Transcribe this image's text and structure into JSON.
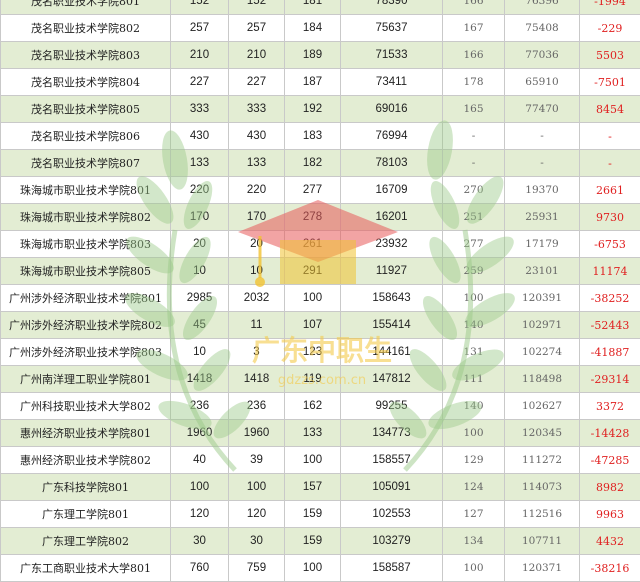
{
  "watermark": {
    "text": "广东中职生",
    "subtext": "gdzzs.com.cn"
  },
  "rows": [
    [
      "茂名职业技术学院801",
      "152",
      "152",
      "181",
      "78390",
      "166",
      "76396",
      "-1994"
    ],
    [
      "茂名职业技术学院802",
      "257",
      "257",
      "184",
      "75637",
      "167",
      "75408",
      "-229"
    ],
    [
      "茂名职业技术学院803",
      "210",
      "210",
      "189",
      "71533",
      "166",
      "77036",
      "5503"
    ],
    [
      "茂名职业技术学院804",
      "227",
      "227",
      "187",
      "73411",
      "178",
      "65910",
      "-7501"
    ],
    [
      "茂名职业技术学院805",
      "333",
      "333",
      "192",
      "69016",
      "165",
      "77470",
      "8454"
    ],
    [
      "茂名职业技术学院806",
      "430",
      "430",
      "183",
      "76994",
      "-",
      "-",
      "-"
    ],
    [
      "茂名职业技术学院807",
      "133",
      "133",
      "182",
      "78103",
      "-",
      "-",
      "-"
    ],
    [
      "珠海城市职业技术学院801",
      "220",
      "220",
      "277",
      "16709",
      "270",
      "19370",
      "2661"
    ],
    [
      "珠海城市职业技术学院802",
      "170",
      "170",
      "278",
      "16201",
      "251",
      "25931",
      "9730"
    ],
    [
      "珠海城市职业技术学院803",
      "20",
      "20",
      "261",
      "23932",
      "277",
      "17179",
      "-6753"
    ],
    [
      "珠海城市职业技术学院805",
      "10",
      "10",
      "291",
      "11927",
      "259",
      "23101",
      "11174"
    ],
    [
      "广州涉外经济职业技术学院801",
      "2985",
      "2032",
      "100",
      "158643",
      "100",
      "120391",
      "-38252"
    ],
    [
      "广州涉外经济职业技术学院802",
      "45",
      "11",
      "107",
      "155414",
      "140",
      "102971",
      "-52443"
    ],
    [
      "广州涉外经济职业技术学院803",
      "10",
      "3",
      "123",
      "144161",
      "131",
      "102274",
      "-41887"
    ],
    [
      "广州南洋理工职业学院801",
      "1418",
      "1418",
      "119",
      "147812",
      "111",
      "118498",
      "-29314"
    ],
    [
      "广州科技职业技术大学802",
      "236",
      "236",
      "162",
      "99255",
      "140",
      "102627",
      "3372"
    ],
    [
      "惠州经济职业技术学院801",
      "1960",
      "1960",
      "133",
      "134773",
      "100",
      "120345",
      "-14428"
    ],
    [
      "惠州经济职业技术学院802",
      "40",
      "39",
      "100",
      "158557",
      "129",
      "111272",
      "-47285"
    ],
    [
      "广东科技学院801",
      "100",
      "100",
      "157",
      "105091",
      "124",
      "114073",
      "8982"
    ],
    [
      "广东理工学院801",
      "120",
      "120",
      "159",
      "102553",
      "127",
      "112516",
      "9963"
    ],
    [
      "广东理工学院802",
      "30",
      "30",
      "159",
      "103279",
      "134",
      "107711",
      "4432"
    ],
    [
      "广东工商职业技术大学801",
      "760",
      "759",
      "100",
      "158587",
      "100",
      "120371",
      "-38216"
    ]
  ]
}
